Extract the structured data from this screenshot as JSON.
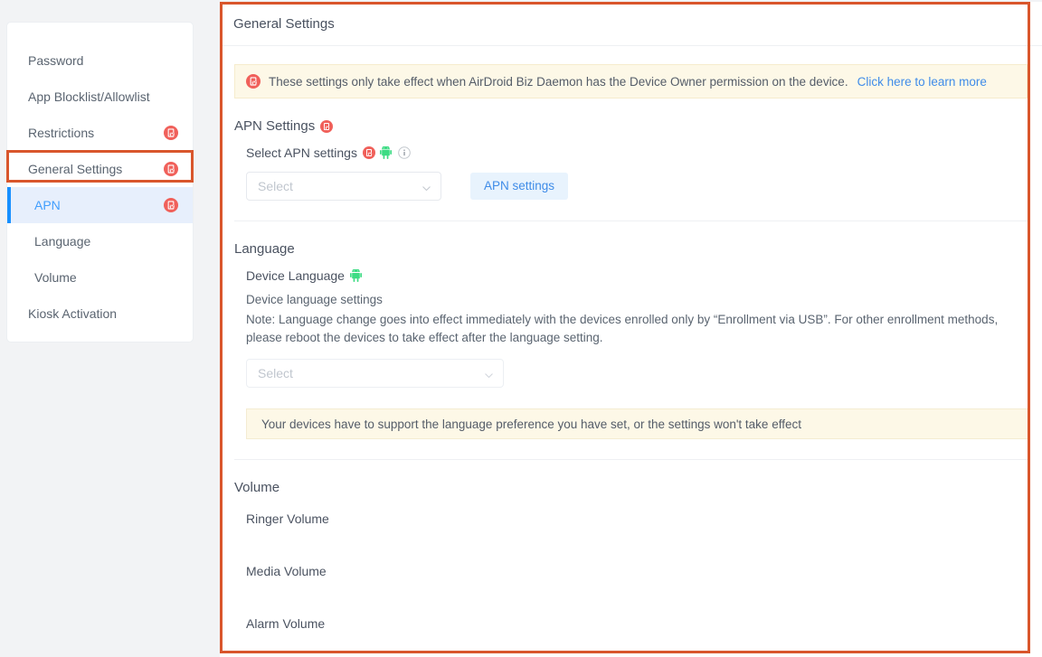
{
  "colors": {
    "accent_blue": "#419efd",
    "link_blue": "#3f8ce8",
    "highlight_orange": "#d9562c",
    "lock_icon_red": "#f0605a",
    "android_green": "#3ddc84",
    "banner_yellow": "#fdf8e7",
    "active_nav_bg": "#e7effc"
  },
  "sidebar": {
    "items": [
      {
        "label": "Password",
        "icon": null,
        "sub": false,
        "active": false
      },
      {
        "label": "App Blocklist/Allowlist",
        "icon": null,
        "sub": false,
        "active": false
      },
      {
        "label": "Restrictions",
        "icon": "device-lock-icon",
        "sub": false,
        "active": false
      },
      {
        "label": "General Settings",
        "icon": "device-lock-icon",
        "sub": false,
        "active": false
      },
      {
        "label": "APN",
        "icon": "device-lock-icon",
        "sub": true,
        "active": true
      },
      {
        "label": "Language",
        "icon": null,
        "sub": true,
        "active": false
      },
      {
        "label": "Volume",
        "icon": null,
        "sub": true,
        "active": false
      },
      {
        "label": "Kiosk Activation",
        "icon": null,
        "sub": false,
        "active": false
      }
    ]
  },
  "panel": {
    "title": "General Settings",
    "alert": {
      "icon": "device-lock-icon",
      "text": "These settings only take effect when AirDroid Biz Daemon has the Device Owner permission on the device.",
      "link_label": "Click here to learn more"
    },
    "apn_section": {
      "title": "APN Settings",
      "title_icon": "device-lock-icon",
      "field_label": "Select APN settings",
      "field_icons": [
        "device-lock-icon",
        "android-icon",
        "info-icon"
      ],
      "select_placeholder": "Select",
      "select_value": "",
      "button_label": "APN settings"
    },
    "language_section": {
      "title": "Language",
      "field_label": "Device Language",
      "field_icons": [
        "android-icon"
      ],
      "description": "Device language settings",
      "note": "Note: Language change goes into effect immediately with the devices enrolled only by “Enrollment via USB”. For other enrollment methods, please reboot the devices to take effect after the language setting.",
      "select_placeholder": "Select",
      "select_value": "",
      "warning": "Your devices have to support the language preference you have set, or the settings won't take effect"
    },
    "volume_section": {
      "title": "Volume",
      "rows": [
        {
          "label": "Ringer Volume"
        },
        {
          "label": "Media Volume"
        },
        {
          "label": "Alarm Volume"
        }
      ]
    }
  }
}
